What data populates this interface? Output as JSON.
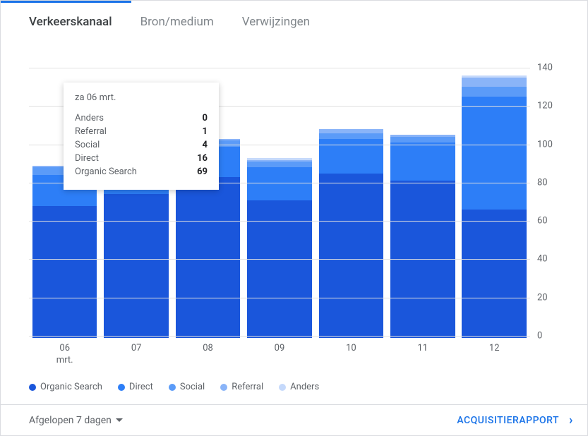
{
  "tabs": [
    {
      "id": "verkeerskanaal",
      "label": "Verkeerskanaal",
      "active": true
    },
    {
      "id": "bronmedium",
      "label": "Bron/medium",
      "active": false
    },
    {
      "id": "verwijzingen",
      "label": "Verwijzingen",
      "active": false
    }
  ],
  "colors": {
    "organic_search": "#1a56db",
    "direct": "#2d7ef7",
    "social": "#5b9bf8",
    "referral": "#8ab4f8",
    "anders": "#c5d9fb"
  },
  "legend": [
    {
      "key": "organic_search",
      "label": "Organic Search"
    },
    {
      "key": "direct",
      "label": "Direct"
    },
    {
      "key": "social",
      "label": "Social"
    },
    {
      "key": "referral",
      "label": "Referral"
    },
    {
      "key": "anders",
      "label": "Anders"
    }
  ],
  "footer": {
    "date_range": "Afgelopen 7 dagen",
    "report_link": "ACQUISITIERAPPORT"
  },
  "tooltip": {
    "title": "za 06 mrt.",
    "rows": [
      {
        "label": "Anders",
        "value": "0"
      },
      {
        "label": "Referral",
        "value": "1"
      },
      {
        "label": "Social",
        "value": "4"
      },
      {
        "label": "Direct",
        "value": "16"
      },
      {
        "label": "Organic Search",
        "value": "69"
      }
    ]
  },
  "chart_data": {
    "type": "bar",
    "stacked": true,
    "ylim": [
      0,
      140
    ],
    "yticks": [
      0,
      20,
      40,
      60,
      80,
      100,
      120,
      140
    ],
    "xlabel": "",
    "ylabel": "",
    "categories": [
      "06",
      "07",
      "08",
      "09",
      "10",
      "11",
      "12"
    ],
    "x_sublabels": [
      "mrt.",
      "",
      "",
      "",
      "",
      "",
      ""
    ],
    "series": [
      {
        "name": "Organic Search",
        "key": "organic_search",
        "values": [
          69,
          75,
          84,
          72,
          86,
          82,
          67
        ]
      },
      {
        "name": "Direct",
        "key": "direct",
        "values": [
          16,
          18,
          16,
          17,
          18,
          20,
          59
        ]
      },
      {
        "name": "Social",
        "key": "social",
        "values": [
          4,
          4,
          3,
          3,
          3,
          3,
          5
        ]
      },
      {
        "name": "Referral",
        "key": "referral",
        "values": [
          1,
          2,
          1,
          1,
          2,
          1,
          5
        ]
      },
      {
        "name": "Anders",
        "key": "anders",
        "values": [
          0,
          1,
          0,
          1,
          0,
          0,
          1
        ]
      }
    ]
  }
}
